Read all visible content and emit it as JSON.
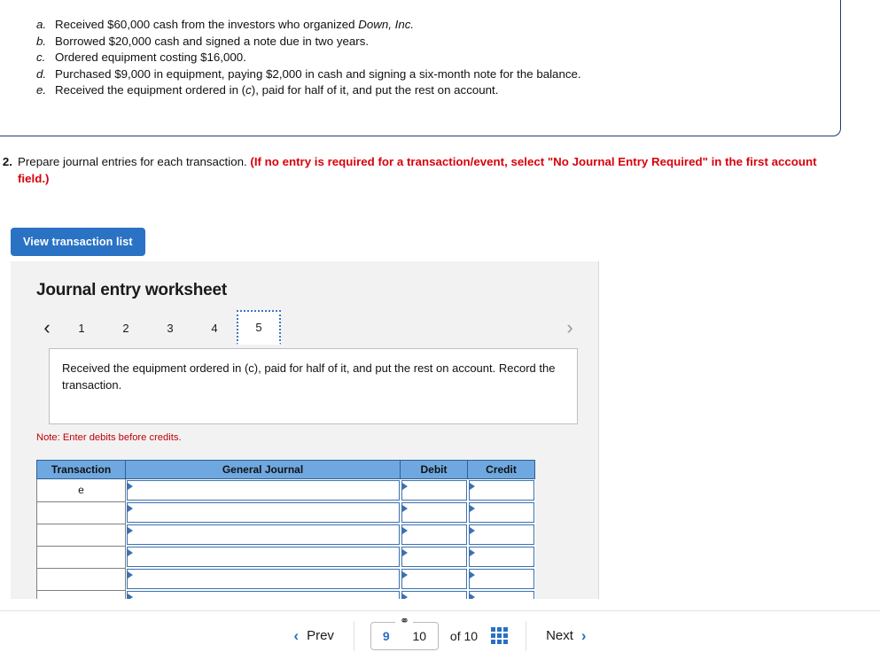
{
  "transaction_box": {
    "items": [
      {
        "marker": "a.",
        "text_before": "Received $60,000 cash from the investors who organized ",
        "italic": "Down, Inc.",
        "text_after": ""
      },
      {
        "marker": "b.",
        "text_before": "Borrowed $20,000 cash and signed a note due in two years.",
        "italic": "",
        "text_after": ""
      },
      {
        "marker": "c.",
        "text_before": "Ordered equipment costing $16,000.",
        "italic": "",
        "text_after": ""
      },
      {
        "marker": "d.",
        "text_before": "Purchased $9,000 in equipment, paying $2,000 in cash and signing a six-month note for the balance.",
        "italic": "",
        "text_after": ""
      },
      {
        "marker": "e.",
        "text_before": "Received the equipment ordered in (",
        "italic": "c",
        "text_after": "), paid for half of it, and put the rest on account."
      }
    ]
  },
  "question": {
    "number": "2.",
    "prompt": "Prepare journal entries for each transaction. ",
    "requirement": "(If no entry is required for a transaction/event, select \"No Journal Entry Required\" in the first account field.)"
  },
  "toolbar": {
    "view_transaction_list_label": "View transaction list"
  },
  "worksheet": {
    "title": "Journal entry worksheet",
    "tabs": [
      "1",
      "2",
      "3",
      "4",
      "5"
    ],
    "active_tab": "5",
    "prev_arrow": "‹",
    "next_arrow": "›",
    "description": "Received the equipment ordered in (c), paid for half of it, and put the rest on account. Record the transaction.",
    "note": "Note: Enter debits before credits.",
    "table": {
      "headers": [
        "Transaction",
        "General Journal",
        "Debit",
        "Credit"
      ],
      "rows": [
        {
          "transaction": "e",
          "general_journal": "",
          "debit": "",
          "credit": ""
        },
        {
          "transaction": "",
          "general_journal": "",
          "debit": "",
          "credit": ""
        },
        {
          "transaction": "",
          "general_journal": "",
          "debit": "",
          "credit": ""
        },
        {
          "transaction": "",
          "general_journal": "",
          "debit": "",
          "credit": ""
        },
        {
          "transaction": "",
          "general_journal": "",
          "debit": "",
          "credit": ""
        },
        {
          "transaction": "",
          "general_journal": "",
          "debit": "",
          "credit": ""
        }
      ]
    }
  },
  "navigation": {
    "prev_label": "Prev",
    "prev_chevron": "‹",
    "current_page": "9",
    "next_page": "10",
    "link_icon": "⚭",
    "of_label": "of 10",
    "grid_icon": "grid-icon",
    "next_label": "Next",
    "next_chevron": "›"
  },
  "colors": {
    "accent_blue": "#2a72c4",
    "table_header_blue": "#6fa8e0",
    "required_red": "#d9000b",
    "note_red": "#c0000a",
    "panel_bg": "#f2f2f2",
    "box_border": "#1f3f70"
  }
}
